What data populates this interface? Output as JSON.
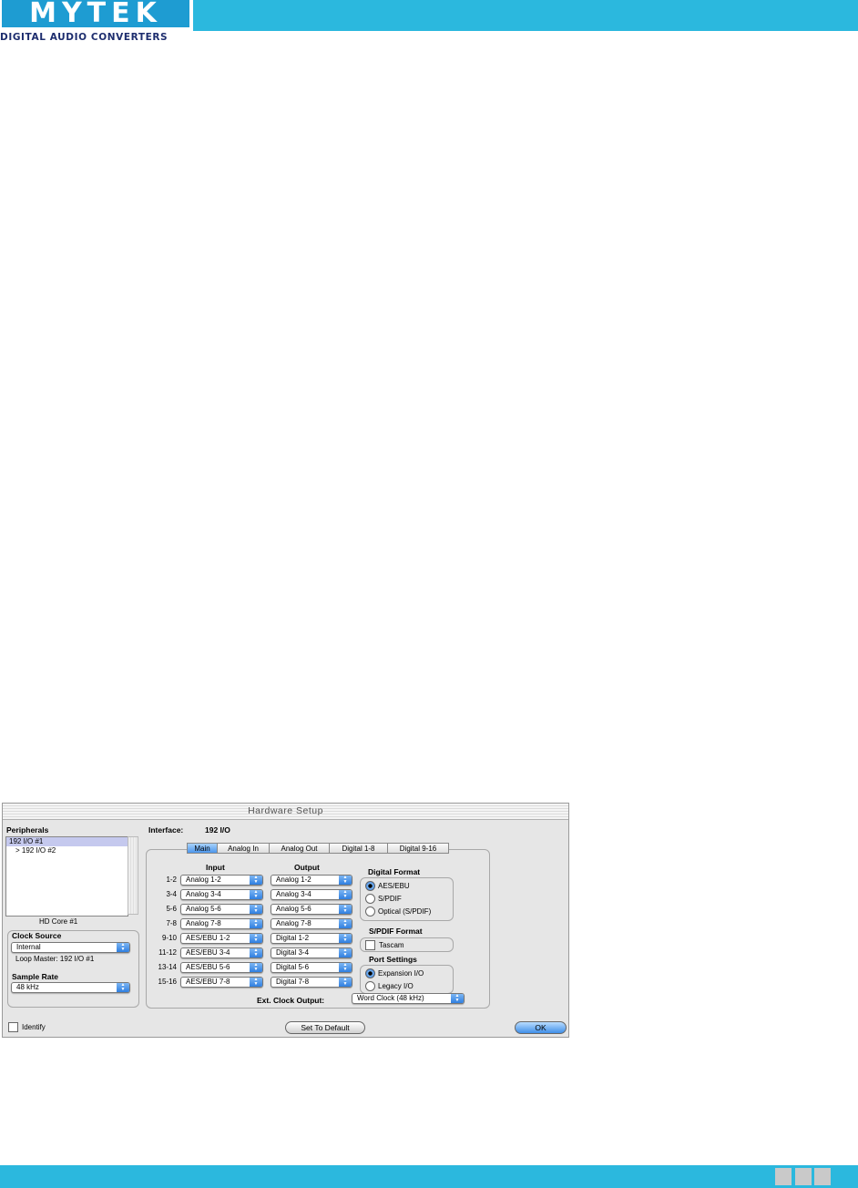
{
  "brand": {
    "logo_text": "MYTEK",
    "tagline": "DIGITAL AUDIO CONVERTERS",
    "bar_color": "#2bb8de"
  },
  "window": {
    "title": "Hardware Setup",
    "peripherals": {
      "label": "Peripherals",
      "items": [
        "192 I/O #1",
        "> 192 I/O #2"
      ],
      "selected_index": 0,
      "core_label": "HD Core #1"
    },
    "clock": {
      "clock_source_label": "Clock Source",
      "clock_source_value": "Internal",
      "loop_master": "Loop Master: 192 I/O #1",
      "sample_rate_label": "Sample Rate",
      "sample_rate_value": "48 kHz"
    },
    "interface": {
      "label": "Interface:",
      "value": "192 I/O"
    },
    "tabs": [
      "Main",
      "Analog In",
      "Analog Out",
      "Digital 1-8",
      "Digital 9-16"
    ],
    "active_tab": "Main",
    "routing": {
      "input_header": "Input",
      "output_header": "Output",
      "rows": [
        {
          "label": "1-2",
          "input": "Analog 1-2",
          "output": "Analog 1-2"
        },
        {
          "label": "3-4",
          "input": "Analog 3-4",
          "output": "Analog 3-4"
        },
        {
          "label": "5-6",
          "input": "Analog 5-6",
          "output": "Analog 5-6"
        },
        {
          "label": "7-8",
          "input": "Analog 7-8",
          "output": "Analog 7-8"
        },
        {
          "label": "9-10",
          "input": "AES/EBU 1-2",
          "output": "Digital 1-2"
        },
        {
          "label": "11-12",
          "input": "AES/EBU 3-4",
          "output": "Digital 3-4"
        },
        {
          "label": "13-14",
          "input": "AES/EBU 5-6",
          "output": "Digital 5-6"
        },
        {
          "label": "15-16",
          "input": "AES/EBU 7-8",
          "output": "Digital 7-8"
        }
      ]
    },
    "digital_format": {
      "label": "Digital Format",
      "options": [
        "AES/EBU",
        "S/PDIF",
        "Optical (S/PDIF)"
      ],
      "selected": "AES/EBU"
    },
    "spdif_format": {
      "label": "S/PDIF Format",
      "checkbox_label": "Tascam",
      "checked": false
    },
    "port_settings": {
      "label": "Port Settings",
      "options": [
        "Expansion I/O",
        "Legacy I/O"
      ],
      "selected": "Expansion I/O"
    },
    "ext_clock": {
      "label": "Ext. Clock Output:",
      "value": "Word Clock (48 kHz)"
    },
    "footer": {
      "identify_label": "Identify",
      "identify_checked": false,
      "set_default_label": "Set To Default",
      "ok_label": "OK"
    }
  }
}
